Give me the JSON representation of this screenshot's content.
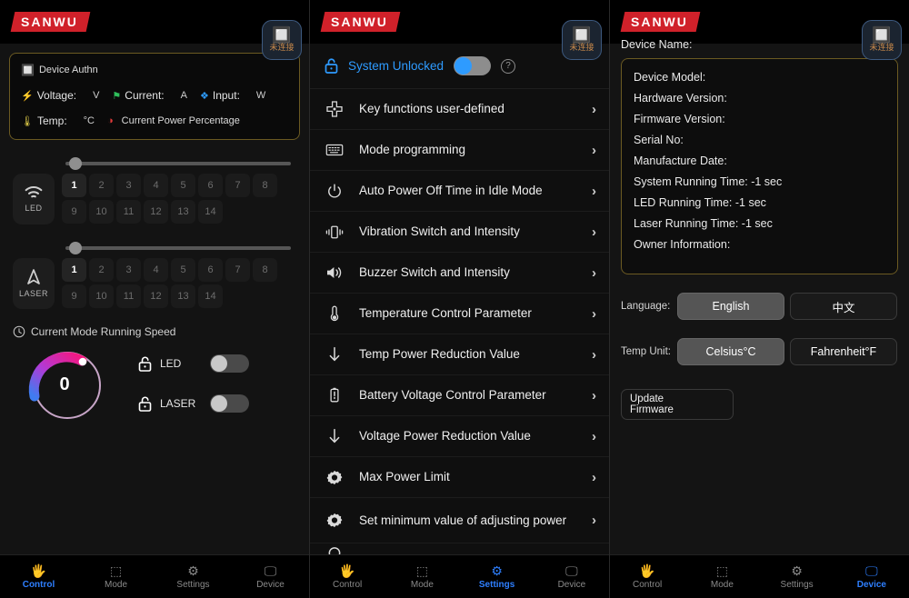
{
  "brand": "SANWU",
  "bluetooth": {
    "icon": "bluetooth-icon",
    "status_cn": "未连接"
  },
  "control": {
    "authn_title": "Device Authn",
    "metrics": [
      {
        "icon": "bolt-icon",
        "label": "Voltage:",
        "unit": "V"
      },
      {
        "icon": "current-icon",
        "label": "Current:",
        "unit": "A"
      },
      {
        "icon": "plug-icon",
        "label": "Input:",
        "unit": "W"
      }
    ],
    "temp_label": "Temp:",
    "temp_unit": "°C",
    "power_percentage_label": "Current Power Percentage",
    "led": {
      "name": "LED",
      "icon": "wifi-icon",
      "selected": "1",
      "numbers": [
        "1",
        "2",
        "3",
        "4",
        "5",
        "6",
        "7",
        "8",
        "9",
        "10",
        "11",
        "12",
        "13",
        "14"
      ]
    },
    "laser": {
      "name": "LASER",
      "icon": "navigation-icon",
      "selected": "1",
      "numbers": [
        "1",
        "2",
        "3",
        "4",
        "5",
        "6",
        "7",
        "8",
        "9",
        "10",
        "11",
        "12",
        "13",
        "14"
      ]
    },
    "speed_title": "Current Mode Running Speed",
    "speed_value": "0",
    "locks": [
      {
        "name": "LED",
        "icon": "unlock-icon",
        "enabled": false
      },
      {
        "name": "LASER",
        "icon": "unlock-icon",
        "enabled": false
      }
    ]
  },
  "settings": {
    "system_lock_label": "System Unlocked",
    "system_unlocked": true,
    "help_icon": "question-mark-icon",
    "items": [
      {
        "label": "Key functions user-defined",
        "icon": "dpad-icon"
      },
      {
        "label": "Mode programming",
        "icon": "keyboard-icon"
      },
      {
        "label": "Auto Power Off Time in Idle Mode",
        "icon": "power-icon"
      },
      {
        "label": "Vibration Switch and Intensity",
        "icon": "vibration-icon"
      },
      {
        "label": "Buzzer Switch and Intensity",
        "icon": "speaker-icon"
      },
      {
        "label": "Temperature Control Parameter",
        "icon": "thermometer-icon"
      },
      {
        "label": "Temp Power Reduction Value",
        "icon": "arrow-down-icon"
      },
      {
        "label": "Battery Voltage Control Parameter",
        "icon": "battery-icon"
      },
      {
        "label": "Voltage Power Reduction Value",
        "icon": "arrow-down-icon"
      },
      {
        "label": "Max Power Limit",
        "icon": "gear-icon"
      },
      {
        "label": "Set minimum value of adjusting power",
        "icon": "gear-icon"
      }
    ]
  },
  "device": {
    "name_label": "Device Name:",
    "info": [
      "Device Model:",
      "Hardware Version:",
      "Firmware Version:",
      "Serial No:",
      "Manufacture Date:",
      "System Running Time: -1 sec",
      "LED Running Time: -1 sec",
      "Laser Running Time: -1 sec",
      "Owner Information:"
    ],
    "language_label": "Language:",
    "language_options": [
      {
        "label": "English",
        "selected": true
      },
      {
        "label": "中文",
        "selected": false
      }
    ],
    "temp_unit_label": "Temp Unit:",
    "temp_unit_options": [
      {
        "label": "Celsius°C",
        "selected": true
      },
      {
        "label": "Fahrenheit°F",
        "selected": false
      }
    ],
    "update_firmware_label": "Update\nFirmware"
  },
  "nav": {
    "items": [
      {
        "label": "Control",
        "icon": "hand-icon"
      },
      {
        "label": "Mode",
        "icon": "mode-icon"
      },
      {
        "label": "Settings",
        "icon": "gear-icon"
      },
      {
        "label": "Device",
        "icon": "device-icon"
      }
    ],
    "active_panel_1": "Control",
    "active_panel_2": "Settings",
    "active_panel_3": "Device"
  },
  "colors": {
    "accent": "#2e7fff",
    "brand": "#d0212a",
    "border_gold": "#6b5a22",
    "bt_text": "#c98a4b"
  }
}
